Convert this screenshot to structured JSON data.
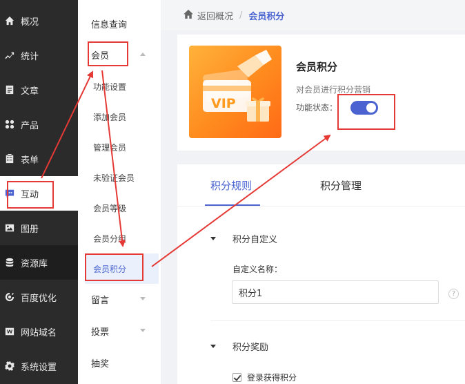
{
  "sidebar": {
    "items": [
      {
        "label": "概况",
        "icon": "home-icon"
      },
      {
        "label": "统计",
        "icon": "chart-icon"
      },
      {
        "label": "文章",
        "icon": "article-icon"
      },
      {
        "label": "产品",
        "icon": "product-grid-icon"
      },
      {
        "label": "表单",
        "icon": "form-icon"
      },
      {
        "label": "互动",
        "icon": "chat-bubble-icon"
      },
      {
        "label": "图册",
        "icon": "gallery-icon"
      },
      {
        "label": "资源库",
        "icon": "database-icon"
      },
      {
        "label": "百度优化",
        "icon": "seo-icon"
      },
      {
        "label": "网站域名",
        "icon": "domain-icon"
      },
      {
        "label": "系统设置",
        "icon": "gear-icon"
      }
    ],
    "active_index": 5
  },
  "submenu": {
    "items": [
      {
        "label": "信息查询"
      },
      {
        "label": "会员"
      },
      {
        "label": "功能设置"
      },
      {
        "label": "添加会员"
      },
      {
        "label": "管理会员"
      },
      {
        "label": "未验证会员"
      },
      {
        "label": "会员等级"
      },
      {
        "label": "会员分组"
      },
      {
        "label": "会员积分"
      },
      {
        "label": "留言"
      },
      {
        "label": "投票"
      },
      {
        "label": "抽奖"
      }
    ]
  },
  "breadcrumb": {
    "back": "返回概况",
    "separator": "/",
    "current": "会员积分"
  },
  "feature": {
    "title": "会员积分",
    "description": "对会员进行积分营销",
    "status_label": "功能状态：",
    "enabled": true,
    "banner_text": "VIP"
  },
  "tabs": [
    {
      "label": "积分规则",
      "active": true
    },
    {
      "label": "积分管理",
      "active": false
    }
  ],
  "rules": {
    "section1_title": "积分自定义",
    "name_label": "自定义名称：",
    "name_value": "积分1",
    "help": "?",
    "section2_title": "积分奖励",
    "checkbox_label": "登录获得积分",
    "checkbox_checked": true
  },
  "colors": {
    "accent": "#4a63d1",
    "sidebar_bg": "#2b2b2b",
    "annotation": "#e53935",
    "banner_orange": "#ff8a1e"
  }
}
